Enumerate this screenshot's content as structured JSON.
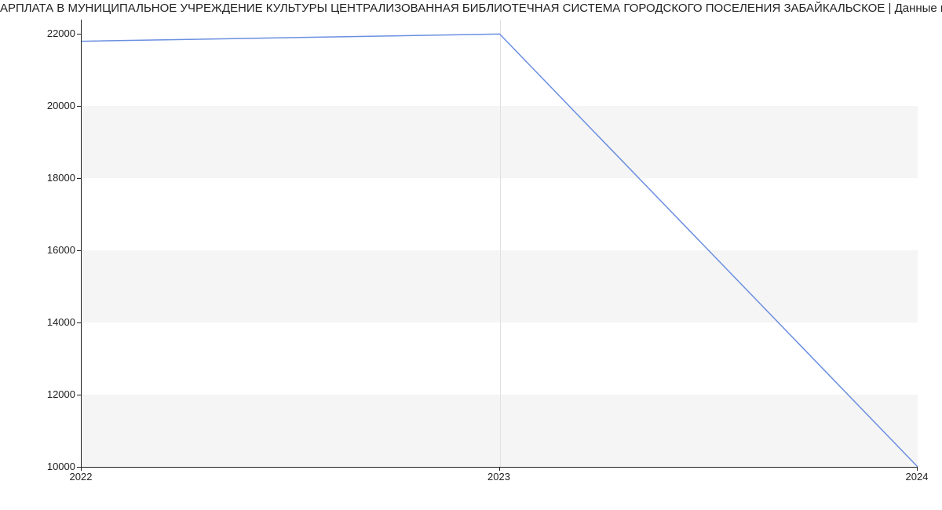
{
  "chart_data": {
    "type": "line",
    "title": "АРПЛАТА В МУНИЦИПАЛЬНОЕ УЧРЕЖДЕНИЕ КУЛЬТУРЫ ЦЕНТРАЛИЗОВАННАЯ БИБЛИОТЕЧНАЯ СИСТЕМА ГОРОДСКОГО ПОСЕЛЕНИЯ ЗАБАЙКАЛЬСКОЕ | Данные mnogo.wor",
    "x": [
      2022,
      2023,
      2024
    ],
    "values": [
      21800,
      22000,
      10000
    ],
    "xlabel": "",
    "ylabel": "",
    "ylim": [
      10000,
      22400
    ],
    "xlim": [
      2022,
      2024
    ],
    "yticks": [
      10000,
      12000,
      14000,
      16000,
      18000,
      20000,
      22000
    ],
    "xticks": [
      2022,
      2023,
      2024
    ],
    "line_color": "#6b8fe0",
    "band_color": "#f5f5f5"
  }
}
